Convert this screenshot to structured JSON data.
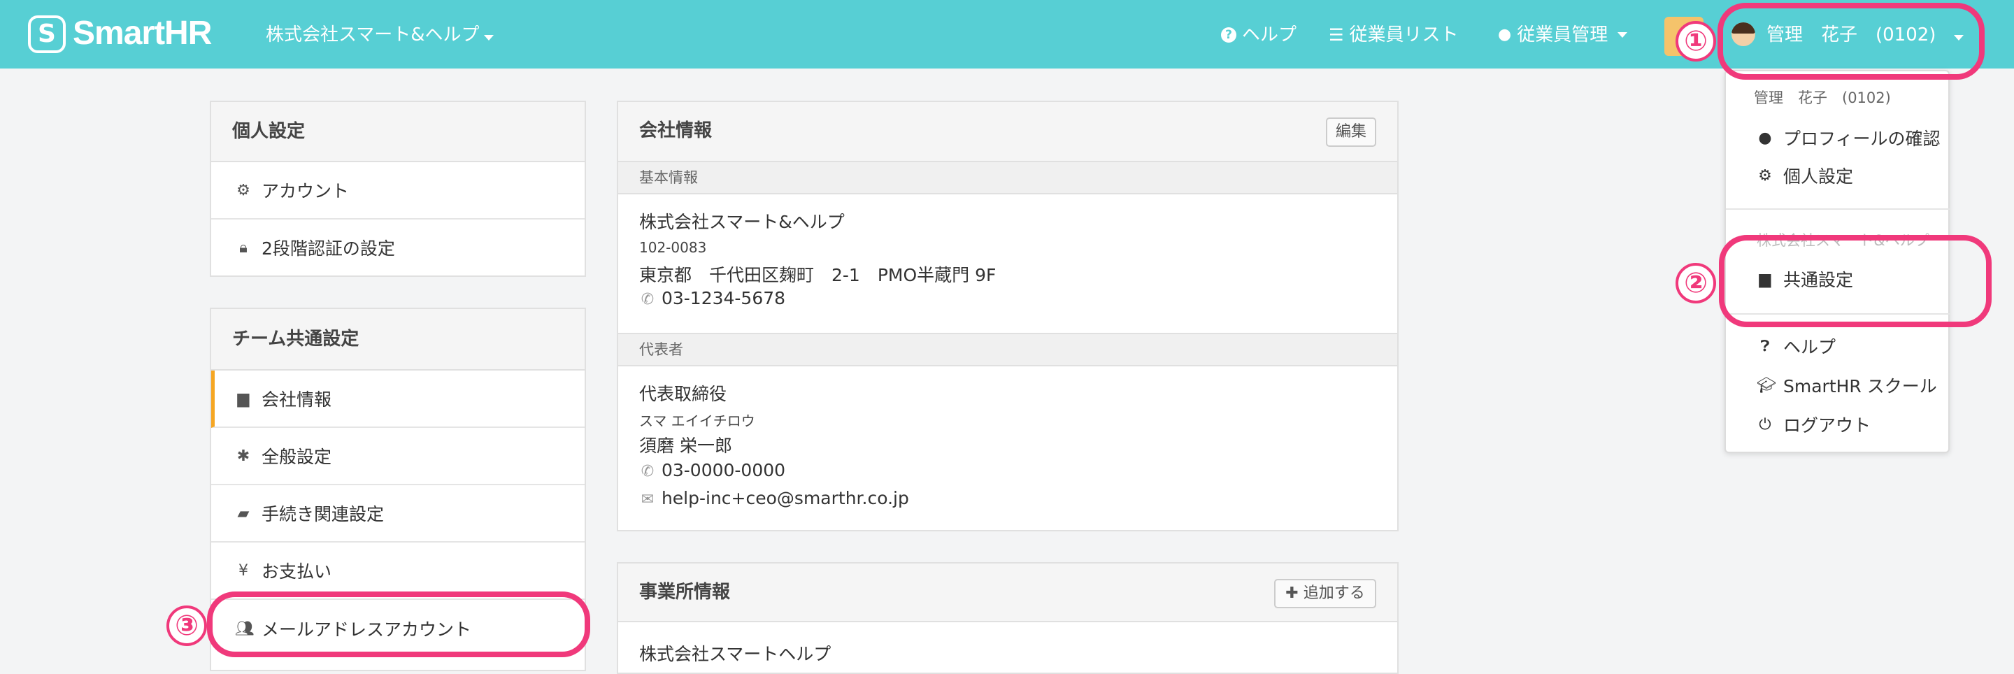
{
  "header": {
    "logo_glyph": "S",
    "logo_text": "SmartHR",
    "company": "株式会社スマート&ヘルプ",
    "nav": {
      "help": "ヘルプ",
      "employee_list": "従業員リスト",
      "employee_mgmt": "従業員管理"
    },
    "user": "管理　花子　(0102)"
  },
  "sidebar": {
    "personal": {
      "title": "個人設定",
      "items": [
        "アカウント",
        "2段階認証の設定"
      ]
    },
    "team": {
      "title": "チーム共通設定",
      "items": [
        "会社情報",
        "全般設定",
        "手続き関連設定",
        "お支払い",
        "メールアドレスアカウント"
      ]
    }
  },
  "company_card": {
    "title": "会社情報",
    "edit": "編集",
    "basic_label": "基本情報",
    "name": "株式会社スマート&ヘルプ",
    "zip": "102-0083",
    "address": "東京都　千代田区麹町　2-1　PMO半蔵門 9F",
    "phone": "03-1234-5678",
    "rep_label": "代表者",
    "rep_title": "代表取締役",
    "rep_kana": "スマ エイイチロウ",
    "rep_name": "須磨 栄一郎",
    "rep_phone": "03-0000-0000",
    "rep_email": "help-inc+ceo@smarthr.co.jp"
  },
  "office_card": {
    "title": "事業所情報",
    "add": "追加する",
    "first_office": "株式会社スマートヘルプ"
  },
  "dropdown": {
    "user_label": "管理　花子　(0102)",
    "profile": "プロフィールの確認",
    "personal": "個人設定",
    "company_faded": "株式会社スマート&ヘルプ",
    "common": "共通設定",
    "help": "ヘルプ",
    "school": "SmartHR スクール",
    "logout": "ログアウト"
  },
  "annotations": {
    "n1": "①",
    "n2": "②",
    "n3": "③"
  },
  "colors": {
    "header": "#57cfd4",
    "highlight": "#f0397b",
    "active_bar": "#f5a623"
  }
}
